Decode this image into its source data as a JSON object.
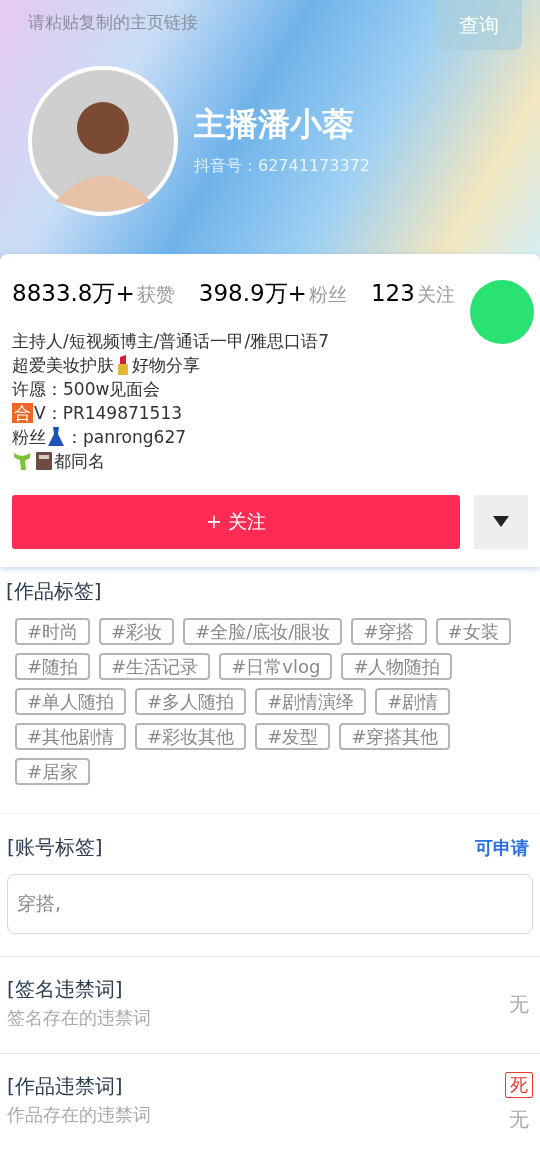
{
  "search": {
    "placeholder": "请粘贴复制的主页链接",
    "button": "查询"
  },
  "profile": {
    "name": "主播潘小蓉",
    "account_id": "抖音号：62741173372"
  },
  "stats": [
    {
      "count": "8833.8万+",
      "caption": "获赞"
    },
    {
      "count": "398.9万+",
      "caption": "粉丝"
    },
    {
      "count": "123",
      "caption": "关注"
    }
  ],
  "bio": [
    [
      {
        "kind": "text",
        "text": "主持人/短视频博主/普通话一甲/雅思口语7"
      }
    ],
    [
      {
        "kind": "text",
        "text": "超爱美妆护肤"
      },
      {
        "kind": "lipstick"
      },
      {
        "kind": "text",
        "text": "好物分享"
      }
    ],
    [
      {
        "kind": "text",
        "text": "许愿：500w见面会"
      }
    ],
    [
      {
        "kind": "badge",
        "text": "合"
      },
      {
        "kind": "text",
        "text": "V：PR149871513"
      }
    ],
    [
      {
        "kind": "text",
        "text": "粉丝"
      },
      {
        "kind": "dress"
      },
      {
        "kind": "text",
        "text": "：panrong627"
      }
    ],
    [
      {
        "kind": "scarf"
      },
      {
        "kind": "book"
      },
      {
        "kind": "text",
        "text": "都同名"
      }
    ]
  ],
  "follow_button": "+ 关注",
  "work_tags": {
    "title": "[作品标签]",
    "tags": [
      "#时尚",
      "#彩妆",
      "#全脸/底妆/眼妆",
      "#穿搭",
      "#女装",
      "#随拍",
      "#生活记录",
      "#日常vlog",
      "#人物随拍",
      "#单人随拍",
      "#多人随拍",
      "#剧情演绎",
      "#剧情",
      "#其他剧情",
      "#彩妆其他",
      "#发型",
      "#穿搭其他",
      "#居家"
    ]
  },
  "account_tags": {
    "title": "[账号标签]",
    "link": "可申请",
    "value": "穿搭,"
  },
  "checks": [
    {
      "title": "[签名违禁词]",
      "subtitle": "签名存在的违禁词",
      "result": "无"
    },
    {
      "title": "[作品违禁词]",
      "subtitle": "作品存在的违禁词",
      "badge": "死",
      "result": "无"
    }
  ]
}
